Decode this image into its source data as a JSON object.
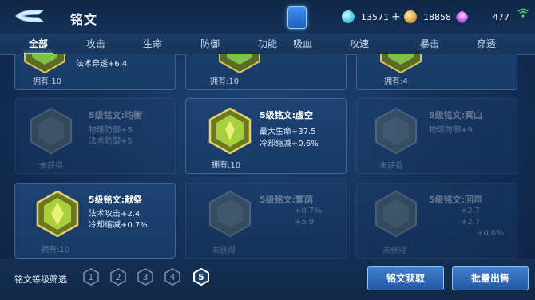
{
  "header": {
    "title": "铭文",
    "resources": [
      {
        "icon": "gem-icon",
        "value": "13571"
      },
      {
        "icon": "coin-icon",
        "value": "18858"
      },
      {
        "icon": "diamond-icon",
        "value": "477"
      }
    ]
  },
  "tabs": [
    {
      "label": "全部",
      "active": true
    },
    {
      "label": "攻击",
      "active": false
    },
    {
      "label": "生命",
      "active": false
    },
    {
      "label": "防御",
      "active": false
    },
    {
      "label": "功能",
      "active": false
    },
    {
      "label": "吸血",
      "active": false
    },
    {
      "label": "攻速",
      "active": false
    },
    {
      "label": "暴击",
      "active": false
    },
    {
      "label": "穿透",
      "active": false
    }
  ],
  "cards": [
    {
      "name": "",
      "stats": [
        "法术穿透+6.4"
      ],
      "footer": "拥有:10",
      "owned": true
    },
    {
      "name": "",
      "stats": [],
      "footer": "拥有:10",
      "owned": true
    },
    {
      "name": "",
      "stats": [],
      "footer": "拥有:4",
      "owned": true
    },
    {
      "name": "5级铭文:均衡",
      "stats": [
        "物理防御+5",
        "法术防御+5"
      ],
      "footer": "未获得",
      "owned": false
    },
    {
      "name": "5级铭文:虚空",
      "stats": [
        "最大生命+37.5",
        "冷却缩减+0.6%"
      ],
      "footer": "拥有:10",
      "owned": true
    },
    {
      "name": "5级铭文:冥山",
      "stats": [
        "物理防御+9"
      ],
      "footer": "未获得",
      "owned": false
    },
    {
      "name": "5级铭文:献祭",
      "stats": [
        "法术攻击+2.4",
        "冷却缩减+0.7%"
      ],
      "footer": "拥有:10",
      "owned": true
    },
    {
      "name": "5级铭文:繁荫",
      "stats": [
        "+0.7%",
        "+5.9"
      ],
      "footer": "未获得",
      "owned": false
    },
    {
      "name": "5级铭文:回声",
      "stats": [
        "+2.7",
        "+2.7",
        "+0.6%"
      ],
      "footer": "未获得",
      "owned": false
    }
  ],
  "filter": {
    "label": "铭文等级筛选",
    "levels": [
      "1",
      "2",
      "3",
      "4",
      "5"
    ],
    "selected": "5"
  },
  "buttons": {
    "acquire": "铭文获取",
    "sell": "批量出售"
  }
}
